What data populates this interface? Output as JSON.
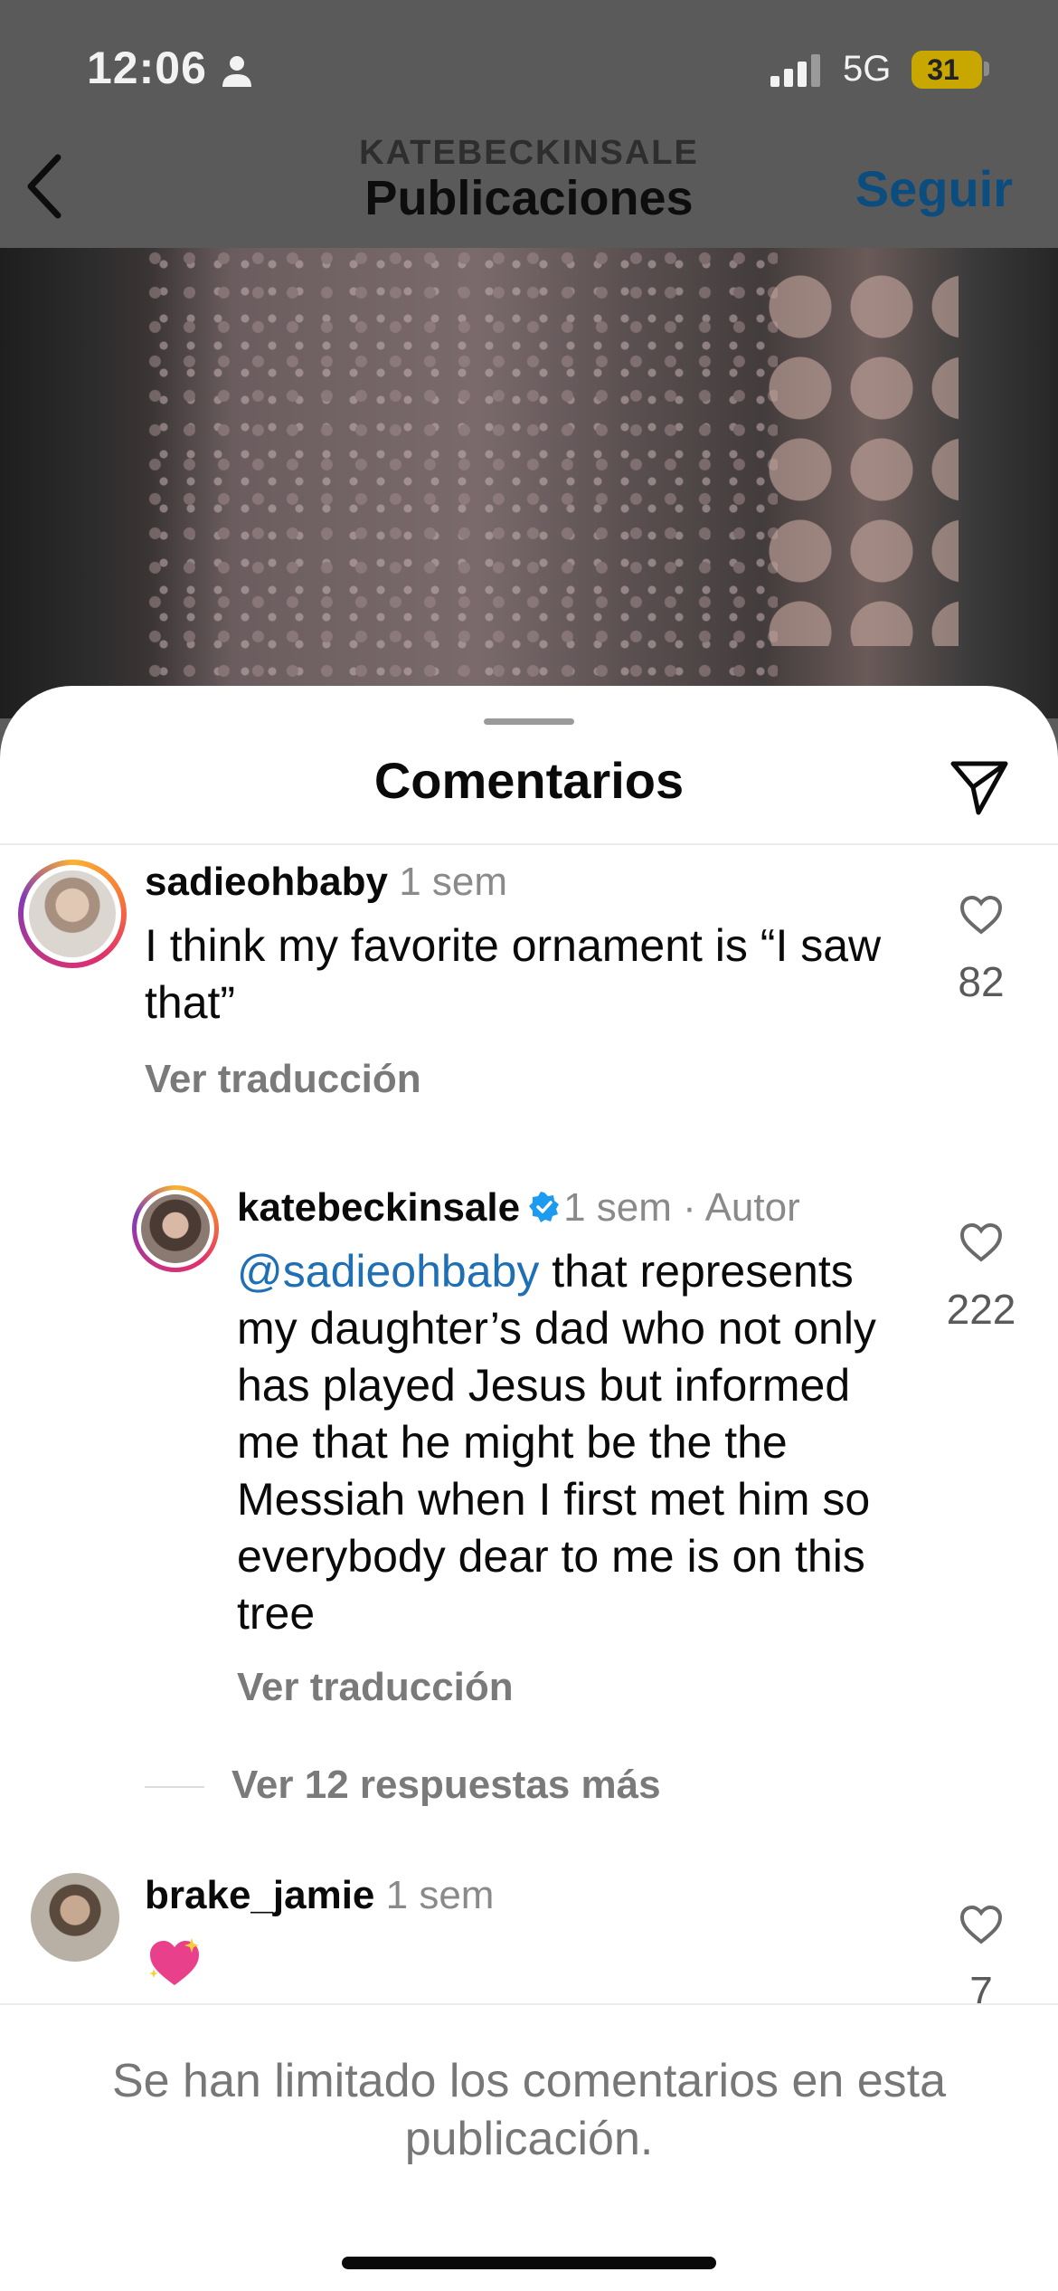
{
  "status_bar": {
    "time": "12:06",
    "network": "5G",
    "battery": "31"
  },
  "nav": {
    "account": "KATEBECKINSALE",
    "title": "Publicaciones",
    "follow_label": "Seguir"
  },
  "sheet": {
    "title": "Comentarios"
  },
  "comments": [
    {
      "username": "sadieohbaby",
      "time": "1 sem",
      "text": "I think my favorite ornament is “I saw that”",
      "translate_label": "Ver traducción",
      "likes": "82"
    },
    {
      "username": "katebeckinsale",
      "meta": "1 sem · Autor",
      "mention": "@sadieohbaby",
      "text": " that represents my daughter’s dad who not only has played Jesus but informed me that he might be the  the Messiah when I first met him so everybody dear to me is on this tree",
      "translate_label": "Ver traducción",
      "likes": "222"
    },
    {
      "username": "brake_jamie",
      "time": "1 sem",
      "likes": "7"
    }
  ],
  "more_replies_label": "Ver 12 respuestas más",
  "footer_text": "Se han limitado los comentarios en esta publicación.",
  "colors": {
    "link_blue": "#1f6fb5",
    "follow_blue": "#0b4d7e",
    "muted_gray": "#7a7a7a",
    "heart_pink": "#e8408a"
  }
}
